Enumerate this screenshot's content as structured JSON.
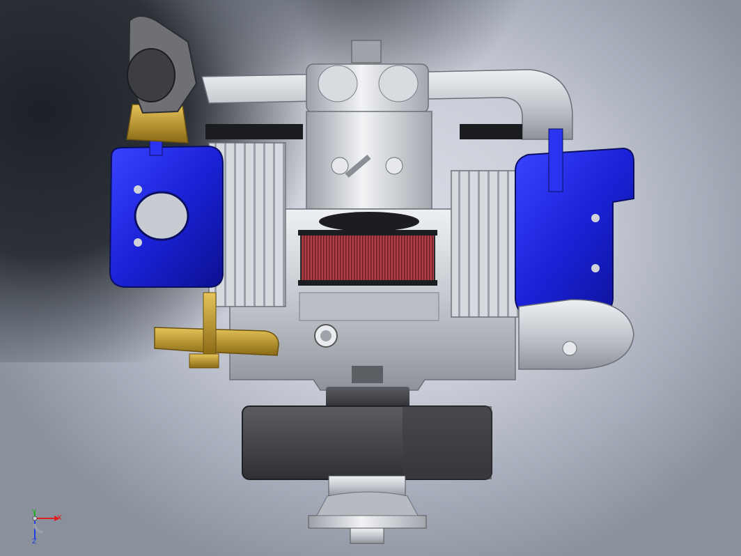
{
  "viewport": {
    "name": "cad-3d-view",
    "model": "opposed-twin-engine-assembly"
  },
  "triad": {
    "x_label": "X",
    "y_label": "Y",
    "z_label": "Z",
    "x_color": "#e02020",
    "y_color": "#20b020",
    "z_color": "#2040e0"
  },
  "colors": {
    "cylinder_head": "#1a22d8",
    "crankcase": "#c9ccd2",
    "brass": "#b8962a",
    "air_filter": "#a0303a",
    "pulley": "#4a4c50"
  },
  "icons": {
    "coordinate-triad": "xyz-axes-icon"
  }
}
